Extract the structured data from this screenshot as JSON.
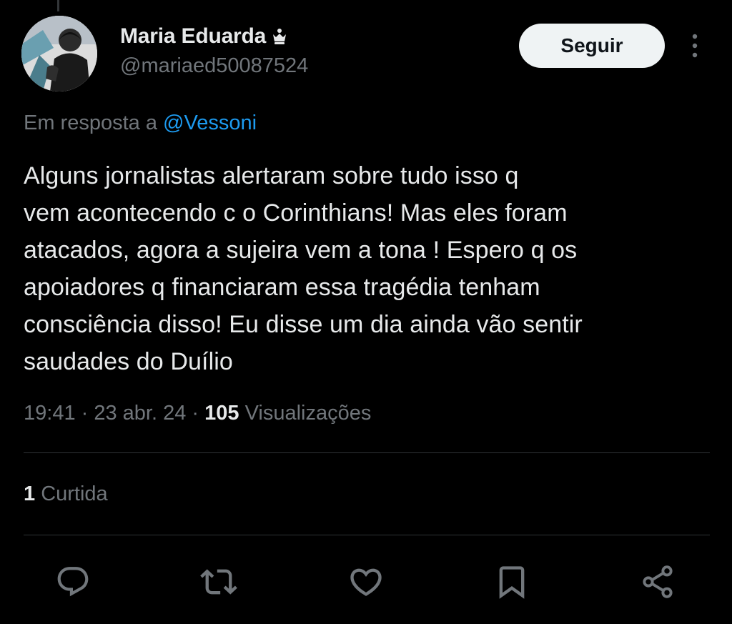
{
  "user": {
    "display_name": "Maria Eduarda",
    "badge_icon": "crown-icon",
    "handle": "@mariaed50087524"
  },
  "follow_button": {
    "label": "Seguir"
  },
  "more_menu": {
    "icon": "more-vertical-icon"
  },
  "reply_context": {
    "prefix": "Em resposta a ",
    "mention": "@Vessoni"
  },
  "tweet": {
    "lines": [
      "Alguns jornalistas alertaram sobre tudo isso q",
      "vem acontecendo c o Corinthians! Mas eles foram",
      "atacados, agora a sujeira vem a tona ! Espero q os",
      "apoiadores q financiaram essa tragédia tenham",
      "consciência disso! Eu disse um dia ainda vão sentir",
      "saudades do Duílio"
    ]
  },
  "meta": {
    "time": "19:41",
    "separator": " · ",
    "date": "23 abr. 24",
    "views_count": "105",
    "views_label": " Visualizações"
  },
  "engagement": {
    "likes_count": "1",
    "likes_label": " Curtida"
  },
  "actions": [
    {
      "icon": "reply-icon"
    },
    {
      "icon": "retweet-icon"
    },
    {
      "icon": "like-icon"
    },
    {
      "icon": "bookmark-icon"
    },
    {
      "icon": "share-icon"
    }
  ],
  "colors": {
    "background": "#000000",
    "text_primary": "#e7e9ea",
    "text_secondary": "#71767b",
    "accent": "#1d9bf0",
    "divider": "#2f3336",
    "button_bg": "#eff3f4"
  }
}
